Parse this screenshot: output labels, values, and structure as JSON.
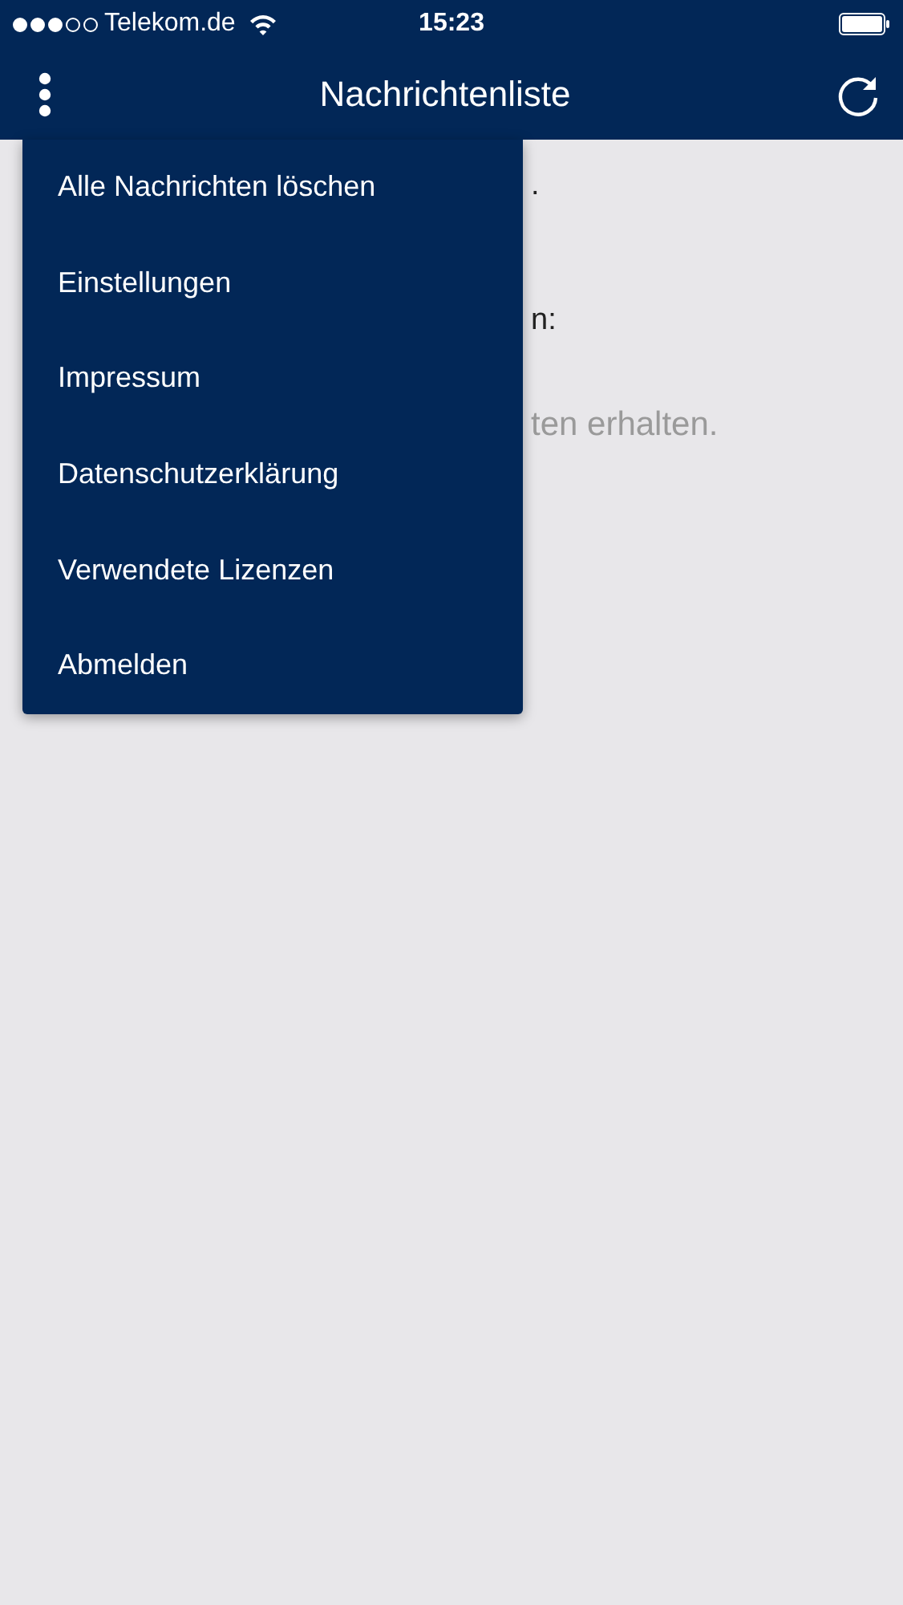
{
  "status_bar": {
    "carrier": "Telekom.de",
    "time": "15:23"
  },
  "nav_bar": {
    "title": "Nachrichtenliste"
  },
  "content": [
    {
      "text": ".",
      "kind": "primary"
    },
    {
      "text": "n:",
      "kind": "primary"
    },
    {
      "text": "ten erhalten.",
      "kind": "muted"
    }
  ],
  "menu": {
    "items": [
      {
        "label": "Alle Nachrichten löschen"
      },
      {
        "label": "Einstellungen"
      },
      {
        "label": "Impressum"
      },
      {
        "label": "Datenschutzerklärung"
      },
      {
        "label": "Verwendete Lizenzen"
      },
      {
        "label": "Abmelden"
      }
    ]
  }
}
